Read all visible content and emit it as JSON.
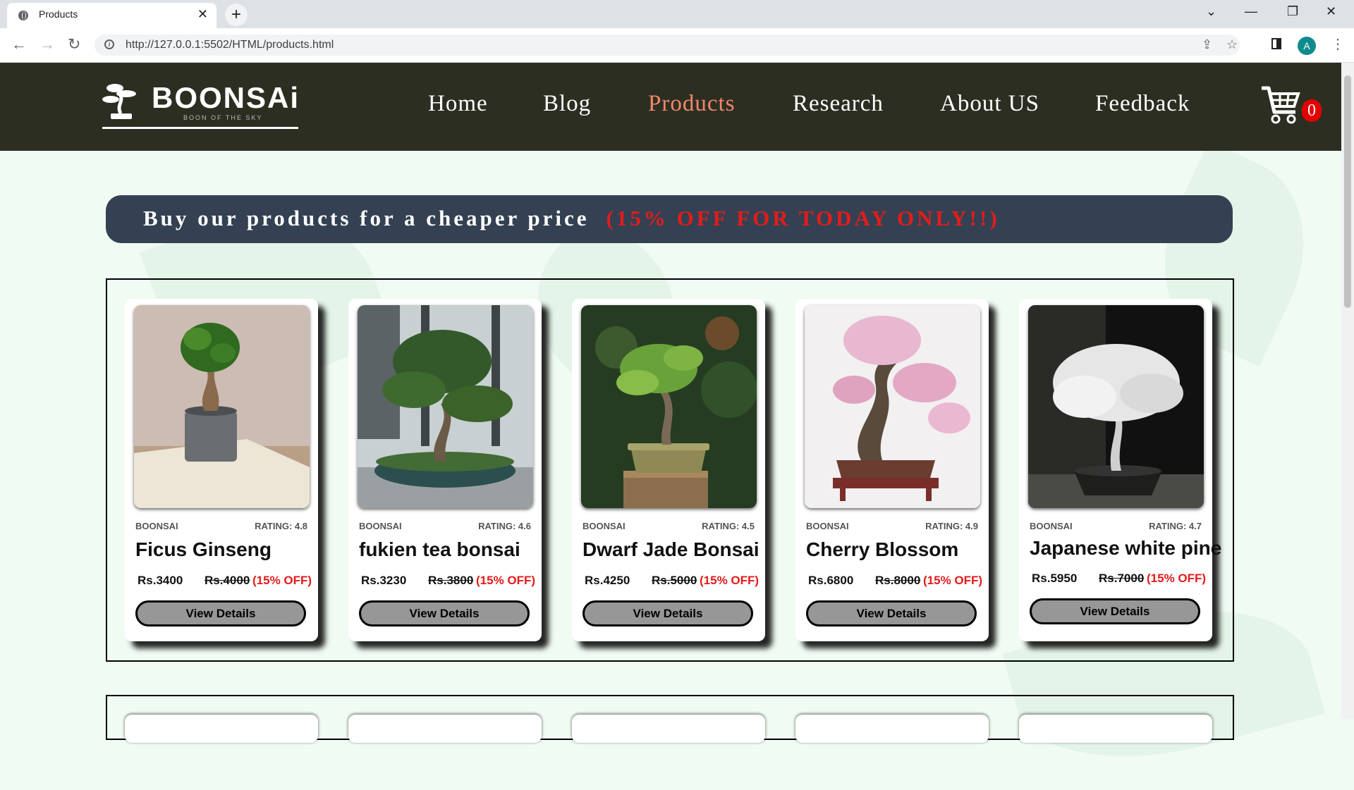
{
  "browser": {
    "tab_title": "Products",
    "url": "http://127.0.0.1:5502/HTML/products.html",
    "profile_initial": "A"
  },
  "header": {
    "brand": "BOONSAi",
    "tagline": "BOON OF THE SKY",
    "nav": [
      {
        "label": "Home",
        "active": false
      },
      {
        "label": "Blog",
        "active": false
      },
      {
        "label": "Products",
        "active": true
      },
      {
        "label": "Research",
        "active": false
      },
      {
        "label": "About US",
        "active": false
      },
      {
        "label": "Feedback",
        "active": false
      }
    ],
    "cart_count": "0"
  },
  "banner": {
    "text": "Buy our products for a cheaper price",
    "offer": "(15% OFF FOR TODAY ONLY!!)"
  },
  "products": [
    {
      "brand": "BOONSAI",
      "rating": "RATING: 4.8",
      "name": "Ficus Ginseng",
      "price": "Rs.3400",
      "old_price": "Rs.4000",
      "discount": "(15% OFF)",
      "button": "View Details"
    },
    {
      "brand": "BOONSAI",
      "rating": "RATING: 4.6",
      "name": "fukien tea bonsai",
      "price": "Rs.3230",
      "old_price": "Rs.3800",
      "discount": "(15% OFF)",
      "button": "View Details"
    },
    {
      "brand": "BOONSAI",
      "rating": "RATING: 4.5",
      "name": "Dwarf Jade Bonsai",
      "price": "Rs.4250",
      "old_price": "Rs.5000",
      "discount": "(15% OFF)",
      "button": "View Details"
    },
    {
      "brand": "BOONSAI",
      "rating": "RATING: 4.9",
      "name": "Cherry Blossom",
      "price": "Rs.6800",
      "old_price": "Rs.8000",
      "discount": "(15% OFF)",
      "button": "View Details"
    },
    {
      "brand": "BOONSAI",
      "rating": "RATING: 4.7",
      "name": "Japanese white pine",
      "price": "Rs.5950",
      "old_price": "Rs.7000",
      "discount": "(15% OFF)",
      "button": "View Details"
    }
  ],
  "colors": {
    "header_bg": "#2d2e22",
    "active_nav": "#f4876a",
    "banner_bg": "#334152",
    "offer_red": "#e41b1b",
    "page_bg": "#f0fbf3"
  }
}
